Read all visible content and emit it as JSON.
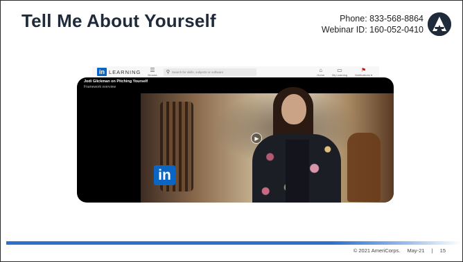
{
  "slide": {
    "title": "Tell Me About Yourself",
    "phone": "Phone: 833-568-8864",
    "webinar": "Webinar ID: 160-052-0410"
  },
  "linkedin": {
    "brand_in": "in",
    "brand_word": "LEARNING",
    "browse_label": "Browse",
    "search_placeholder": "Search for skills, subjects or software",
    "nav": {
      "home": "Home",
      "my_learning": "My Learning",
      "notifications": "Notifications ▾"
    },
    "video": {
      "title": "Jodi Glickman on Pitching Yourself",
      "subtitle": "Framework overview",
      "badge": "in"
    }
  },
  "footer": {
    "copyright": "© 2021 AmeriCorps.",
    "date": "May-21",
    "separator": "|",
    "page": "15"
  },
  "colors": {
    "title": "#1f2a3a",
    "accent_blue": "#2f6fd0",
    "linkedin_blue": "#0a66c2"
  }
}
